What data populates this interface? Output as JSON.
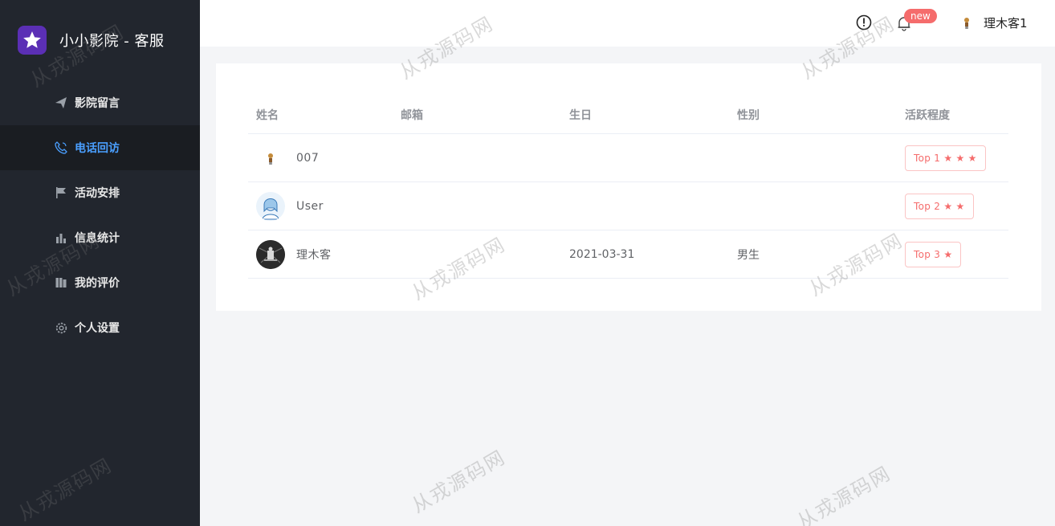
{
  "brand": {
    "title": "小小影院 - 客服"
  },
  "sidebar": {
    "items": [
      {
        "label": "影院留言",
        "icon": "paper-plane-icon"
      },
      {
        "label": "电话回访",
        "icon": "phone-icon",
        "active": true
      },
      {
        "label": "活动安排",
        "icon": "flag-icon"
      },
      {
        "label": "信息统计",
        "icon": "bar-chart-icon"
      },
      {
        "label": "我的评价",
        "icon": "book-icon"
      },
      {
        "label": "个人设置",
        "icon": "gear-icon"
      }
    ]
  },
  "header": {
    "badge": "new",
    "username": "理木客1"
  },
  "table": {
    "columns": [
      "姓名",
      "邮箱",
      "生日",
      "性别",
      "活跃程度"
    ],
    "rows": [
      {
        "name": "007",
        "email": "",
        "birthday": "",
        "gender": "",
        "activity": "Top 1 ★ ★ ★"
      },
      {
        "name": "User",
        "email": "",
        "birthday": "",
        "gender": "",
        "activity": "Top 2 ★ ★"
      },
      {
        "name": "理木客",
        "email": "",
        "birthday": "2021-03-31",
        "gender": "男生",
        "activity": "Top 3 ★"
      }
    ]
  },
  "watermark": "从戎源码网",
  "colors": {
    "sidebar_bg": "#22262e",
    "active_text": "#4a9fff",
    "tag_red": "#f56c6c",
    "badge": "#f56c6c"
  }
}
